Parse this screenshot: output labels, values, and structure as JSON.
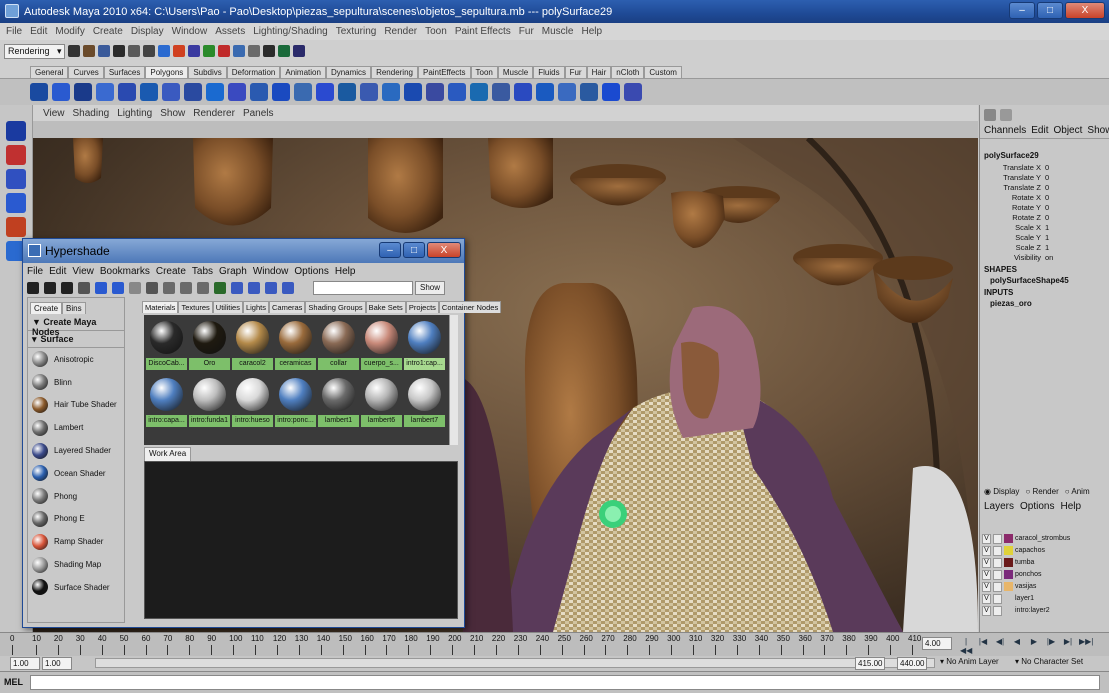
{
  "window": {
    "title": "Autodesk Maya 2010 x64: C:\\Users\\Pao - Pao\\Desktop\\piezas_sepultura\\scenes\\objetos_sepultura.mb  ---  polySurface29",
    "buttons": [
      "–",
      "□",
      "X"
    ]
  },
  "menubar": [
    "File",
    "Edit",
    "Modify",
    "Create",
    "Display",
    "Window",
    "Assets",
    "Lighting/Shading",
    "Texturing",
    "Render",
    "Toon",
    "Paint Effects",
    "Fur",
    "Muscle",
    "Help"
  ],
  "toolbar": {
    "mode": "Rendering"
  },
  "shelf_tabs": [
    "General",
    "Curves",
    "Surfaces",
    "Polygons",
    "Subdivs",
    "Deformation",
    "Animation",
    "Dynamics",
    "Rendering",
    "PaintEffects",
    "Toon",
    "Muscle",
    "Fluids",
    "Fur",
    "Hair",
    "nCloth",
    "Custom"
  ],
  "shelf_active": "Polygons",
  "viewport_menu": [
    "View",
    "Shading",
    "Lighting",
    "Show",
    "Renderer",
    "Panels"
  ],
  "hypershade": {
    "title": "Hypershade",
    "buttons": [
      "–",
      "□",
      "X"
    ],
    "menu": [
      "File",
      "Edit",
      "View",
      "Bookmarks",
      "Create",
      "Tabs",
      "Graph",
      "Window",
      "Options",
      "Help"
    ],
    "show_label": "Show",
    "left_tabs": [
      "Create",
      "Bins"
    ],
    "create_header": "▼ Create Maya Nodes",
    "surface_header": "Surface",
    "nodes": [
      {
        "label": "Anisotropic",
        "color": "#8a8a8a"
      },
      {
        "label": "Blinn",
        "color": "#7a7a7a"
      },
      {
        "label": "Hair Tube Shader",
        "color": "#8b5a2b"
      },
      {
        "label": "Lambert",
        "color": "#6d6d6d"
      },
      {
        "label": "Layered Shader",
        "color": "#3b4a8a"
      },
      {
        "label": "Ocean Shader",
        "color": "#2b5fae"
      },
      {
        "label": "Phong",
        "color": "#7a7a7a"
      },
      {
        "label": "Phong E",
        "color": "#666"
      },
      {
        "label": "Ramp Shader",
        "color": "#d8553a"
      },
      {
        "label": "Shading Map",
        "color": "#9a9a9a"
      },
      {
        "label": "Surface Shader",
        "color": "#111"
      }
    ],
    "right_tabs": [
      "Materials",
      "Textures",
      "Utilities",
      "Lights",
      "Cameras",
      "Shading Groups",
      "Bake Sets",
      "Projects",
      "Container Nodes"
    ],
    "materials": [
      {
        "label": "DiscoCab...",
        "color": "#2a2a2a"
      },
      {
        "label": "Oro",
        "color": "#1f1a10"
      },
      {
        "label": "caracol2",
        "color": "#b48a4a"
      },
      {
        "label": "ceramicas",
        "color": "#9a6b3c"
      },
      {
        "label": "collar",
        "color": "#8a6a55"
      },
      {
        "label": "cuerpo_s...",
        "color": "#c98a7a"
      },
      {
        "label": "intro1:cap...",
        "color": "#4f7fc0"
      },
      {
        "label": "intro:capa...",
        "color": "#4f7fc0"
      },
      {
        "label": "intro:funda1",
        "color": "#bdbdbd"
      },
      {
        "label": "intro:hueso",
        "color": "#d9d9d9"
      },
      {
        "label": "intro:ponc...",
        "color": "#4f7fc0"
      },
      {
        "label": "lambert1",
        "color": "#6a6a6a"
      },
      {
        "label": "lambert6",
        "color": "#b5b5b5"
      },
      {
        "label": "lambert7",
        "color": "#c7c7c7"
      }
    ],
    "work_area_tab": "Work Area"
  },
  "channel_box": {
    "menu": [
      "Channels",
      "Edit",
      "Object",
      "Show"
    ],
    "object": "polySurface29",
    "attributes": [
      {
        "name": "Translate X",
        "value": "0"
      },
      {
        "name": "Translate Y",
        "value": "0"
      },
      {
        "name": "Translate Z",
        "value": "0"
      },
      {
        "name": "Rotate X",
        "value": "0"
      },
      {
        "name": "Rotate Y",
        "value": "0"
      },
      {
        "name": "Rotate Z",
        "value": "0"
      },
      {
        "name": "Scale X",
        "value": "1"
      },
      {
        "name": "Scale Y",
        "value": "1"
      },
      {
        "name": "Scale Z",
        "value": "1"
      },
      {
        "name": "Visibility",
        "value": "on"
      }
    ],
    "shapes_header": "SHAPES",
    "shape": "polySurfaceShape45",
    "inputs_header": "INPUTS",
    "input": "piezas_oro"
  },
  "layers": {
    "radio": [
      "Display",
      "Render",
      "Anim"
    ],
    "menu": [
      "Layers",
      "Options",
      "Help"
    ],
    "items": [
      {
        "name": "caracol_strombus",
        "color": "#8b2a6a",
        "v": "V"
      },
      {
        "name": "capachos",
        "color": "#e0d23a",
        "v": "V"
      },
      {
        "name": "tumba",
        "color": "#6a1a1a",
        "v": "V"
      },
      {
        "name": "ponchos",
        "color": "#7a2a7a",
        "v": "V"
      },
      {
        "name": "vasijas",
        "color": "#e8b66a",
        "v": "V"
      },
      {
        "name": "layer1",
        "color": "",
        "v": "V"
      },
      {
        "name": "intro:layer2",
        "color": "",
        "v": "V"
      }
    ]
  },
  "timeline": {
    "ticks": [
      "10",
      "20",
      "30",
      "40",
      "50",
      "60",
      "70",
      "80",
      "90",
      "100",
      "110",
      "120",
      "130",
      "140",
      "150",
      "160",
      "170",
      "180",
      "190",
      "200",
      "210",
      "220",
      "230",
      "240",
      "250",
      "260",
      "270",
      "280",
      "290",
      "300",
      "310",
      "320",
      "330",
      "340",
      "350",
      "360",
      "370",
      "380",
      "390",
      "400",
      "410"
    ],
    "first": "0",
    "current_frame": "4.00"
  },
  "range": {
    "start": "1.00",
    "start2": "1.00",
    "end": "415.00",
    "end2": "440.00",
    "anim_layer": "No Anim Layer",
    "char_set": "No Character Set"
  },
  "cmdline": {
    "label": "MEL"
  }
}
